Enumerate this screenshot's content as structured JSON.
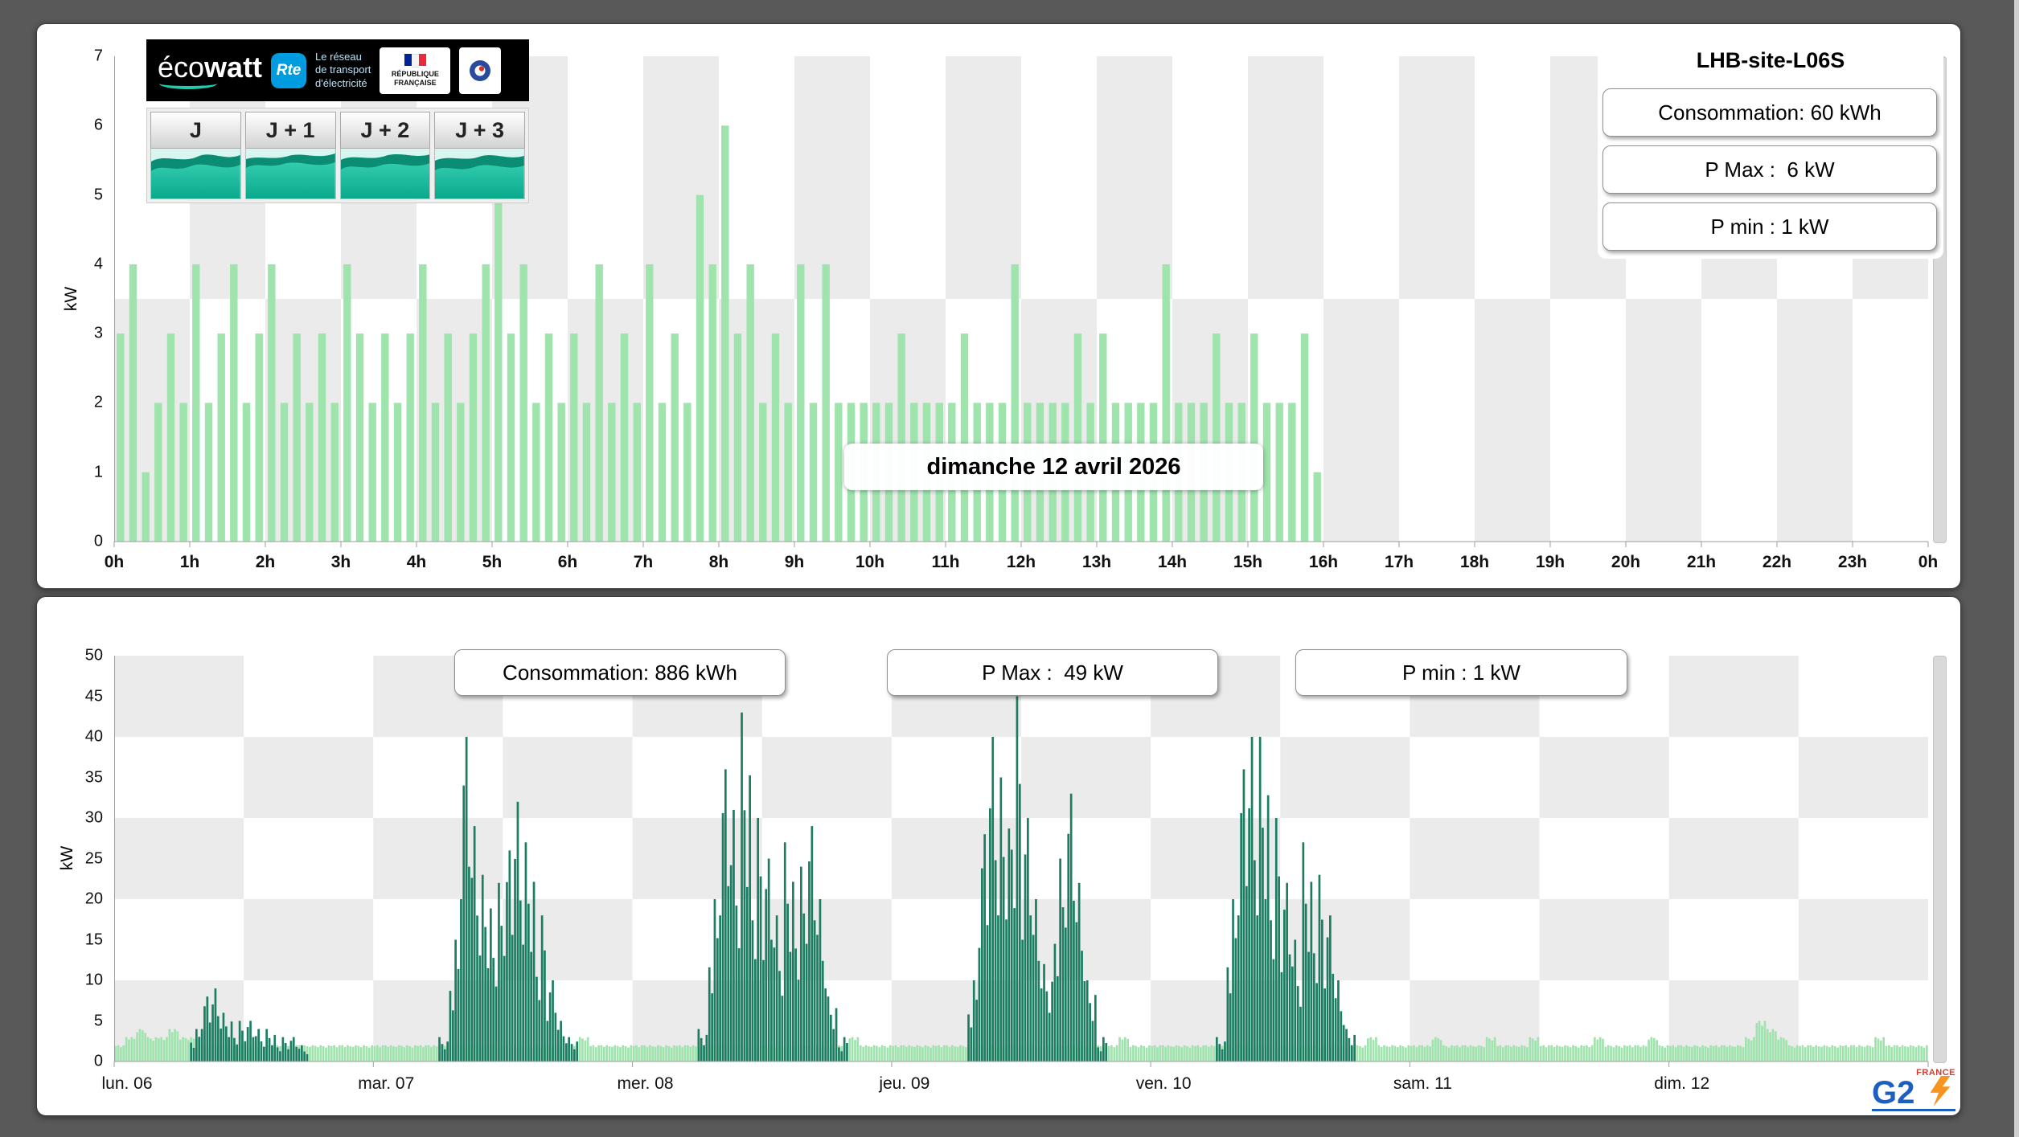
{
  "page": {
    "background": "#595959"
  },
  "top_panel": {
    "site_label": "LHB-site-L06S",
    "y_axis_label": "kW",
    "date_label": "dimanche 12 avril 2026",
    "info_boxes": {
      "consumption": "Consommation: 60 kWh",
      "pmax": "P Max :  6 kW",
      "pmin": "P min : 1 kW"
    },
    "tabs": [
      {
        "label": "J"
      },
      {
        "label": "J + 1"
      },
      {
        "label": "J + 2"
      },
      {
        "label": "J + 3"
      }
    ],
    "logo": {
      "brand_eco": "éco",
      "brand_watt": "watt",
      "rte": "Rte",
      "tagline_line1": "Le réseau",
      "tagline_line2": "de transport",
      "tagline_line3": "d'électricité",
      "gov_line1": "RÉPUBLIQUE",
      "gov_line2": "FRANÇAISE"
    }
  },
  "bottom_panel": {
    "y_axis_label": "kW",
    "info_boxes": {
      "consumption": "Consommation: 886 kWh",
      "pmax": "P Max :  49 kW",
      "pmin": "P min : 1 kW"
    },
    "footer_logo": {
      "g2": "G2",
      "france": "FRANCE"
    }
  },
  "chart_data": [
    {
      "type": "bar",
      "title": "",
      "xlabel": "",
      "ylabel": "kW",
      "unit": "kW",
      "ylim": [
        0,
        7
      ],
      "yticks": [
        0,
        1,
        2,
        3,
        4,
        5,
        6,
        7
      ],
      "x_tick_labels": [
        "0h",
        "1h",
        "2h",
        "3h",
        "4h",
        "5h",
        "6h",
        "7h",
        "8h",
        "9h",
        "10h",
        "11h",
        "12h",
        "13h",
        "14h",
        "15h",
        "16h",
        "17h",
        "18h",
        "19h",
        "20h",
        "21h",
        "22h",
        "23h",
        "0h"
      ],
      "interval_minutes": 10,
      "bar_color": "#9fe3ad",
      "grid": "alternating-bands",
      "legend": "none",
      "annotation": "dimanche 12 avril 2026",
      "stats": {
        "consumption_kwh": 60,
        "p_max_kw": 6,
        "p_min_kw": 1
      },
      "values": [
        3,
        4,
        1,
        2,
        3,
        2,
        4,
        2,
        3,
        4,
        2,
        3,
        4,
        2,
        3,
        2,
        3,
        2,
        4,
        3,
        2,
        3,
        2,
        3,
        4,
        2,
        3,
        2,
        3,
        4,
        5,
        3,
        4,
        2,
        3,
        2,
        3,
        2,
        4,
        2,
        3,
        2,
        4,
        2,
        3,
        2,
        5,
        4,
        6,
        3,
        4,
        2,
        3,
        2,
        4,
        2,
        4,
        2,
        2,
        2,
        2,
        2,
        3,
        2,
        2,
        2,
        2,
        3,
        2,
        2,
        2,
        4,
        2,
        2,
        2,
        2,
        3,
        2,
        3,
        2,
        2,
        2,
        2,
        4,
        2,
        2,
        2,
        3,
        2,
        2,
        3,
        2,
        2,
        2,
        3,
        1,
        0,
        0,
        0,
        0,
        0,
        0,
        0,
        0,
        0,
        0,
        0,
        0,
        0,
        0,
        0,
        0,
        0,
        0,
        0,
        0,
        0,
        0,
        0,
        0,
        0,
        0,
        0,
        0,
        0,
        0,
        0,
        0,
        0,
        0,
        0,
        0,
        0,
        0,
        0,
        0,
        0,
        0,
        0,
        0,
        0,
        0,
        0,
        0
      ]
    },
    {
      "type": "bar",
      "title": "",
      "xlabel": "",
      "ylabel": "kW",
      "unit": "kW",
      "ylim": [
        0,
        50
      ],
      "yticks": [
        0,
        5,
        10,
        15,
        20,
        25,
        30,
        35,
        40,
        45,
        50
      ],
      "categories": [
        "lun. 06",
        "mar. 07",
        "mer. 08",
        "jeu. 09",
        "ven. 10",
        "sam. 11",
        "dim. 12"
      ],
      "interval_minutes": 60,
      "grid": "alternating-bands",
      "legend": "none",
      "stats": {
        "consumption_kwh": 886,
        "p_max_kw": 49,
        "p_min_kw": 1
      },
      "series": [
        {
          "key": "base",
          "name": "base load",
          "color": "#9fe3ad",
          "values": [
            2,
            3,
            4,
            3,
            3,
            4,
            3,
            3,
            2,
            2,
            2,
            2,
            2,
            2,
            2,
            2,
            2,
            2,
            2,
            2,
            2,
            2,
            2,
            2,
            2,
            2,
            2,
            2,
            2,
            2,
            2,
            2,
            2,
            2,
            2,
            2,
            2,
            2,
            2,
            2,
            2,
            2,
            2,
            3,
            2,
            2,
            2,
            2,
            2,
            2,
            2,
            2,
            2,
            2,
            2,
            2,
            2,
            2,
            2,
            2,
            2,
            2,
            2,
            2,
            2,
            2,
            2,
            2,
            3,
            2,
            2,
            2,
            2,
            2,
            2,
            2,
            2,
            2,
            2,
            2,
            2,
            2,
            2,
            2,
            2,
            2,
            2,
            2,
            2,
            2,
            2,
            2,
            2,
            3,
            2,
            2,
            2,
            2,
            2,
            2,
            2,
            2,
            2,
            2,
            2,
            2,
            2,
            2,
            2,
            2,
            2,
            2,
            2,
            2,
            2,
            2,
            3,
            2,
            2,
            2,
            2,
            2,
            3,
            2,
            2,
            2,
            2,
            3,
            2,
            2,
            2,
            3,
            2,
            2,
            2,
            2,
            2,
            3,
            2,
            2,
            2,
            2,
            3,
            2,
            2,
            2,
            2,
            2,
            2,
            2,
            2,
            3,
            5,
            4,
            3,
            2,
            2,
            2,
            2,
            2,
            2,
            2,
            2,
            3,
            2,
            2,
            2,
            2
          ]
        },
        {
          "key": "peaks",
          "name": "peak load",
          "color": "#1b7e62",
          "values": [
            0,
            0,
            0,
            0,
            0,
            0,
            0,
            4,
            8,
            9,
            6,
            5,
            5,
            4,
            4,
            3,
            3,
            2,
            0,
            0,
            0,
            0,
            0,
            0,
            0,
            0,
            0,
            0,
            0,
            0,
            3,
            15,
            40,
            29,
            23,
            22,
            26,
            32,
            27,
            18,
            10,
            5,
            3,
            0,
            0,
            0,
            0,
            0,
            0,
            0,
            0,
            0,
            0,
            0,
            4,
            20,
            36,
            31,
            43,
            30,
            25,
            18,
            27,
            24,
            29,
            20,
            8,
            3,
            0,
            0,
            0,
            0,
            0,
            0,
            0,
            0,
            0,
            0,
            0,
            10,
            28,
            40,
            35,
            45,
            30,
            20,
            12,
            25,
            33,
            22,
            10,
            3,
            0,
            0,
            0,
            0,
            0,
            0,
            0,
            0,
            0,
            0,
            3,
            20,
            36,
            40,
            40,
            30,
            22,
            15,
            27,
            23,
            18,
            10,
            4,
            0,
            0,
            0,
            0,
            0,
            0,
            0,
            0,
            0,
            0,
            0,
            0,
            0,
            0,
            0,
            0,
            0,
            0,
            0,
            0,
            0,
            0,
            0,
            0,
            0,
            0,
            0,
            0,
            0,
            0,
            0,
            0,
            0,
            0,
            0,
            0,
            0,
            0,
            0,
            0,
            0,
            0,
            0,
            0,
            0,
            0,
            0,
            0,
            0,
            0,
            0,
            0,
            0
          ]
        }
      ]
    }
  ]
}
